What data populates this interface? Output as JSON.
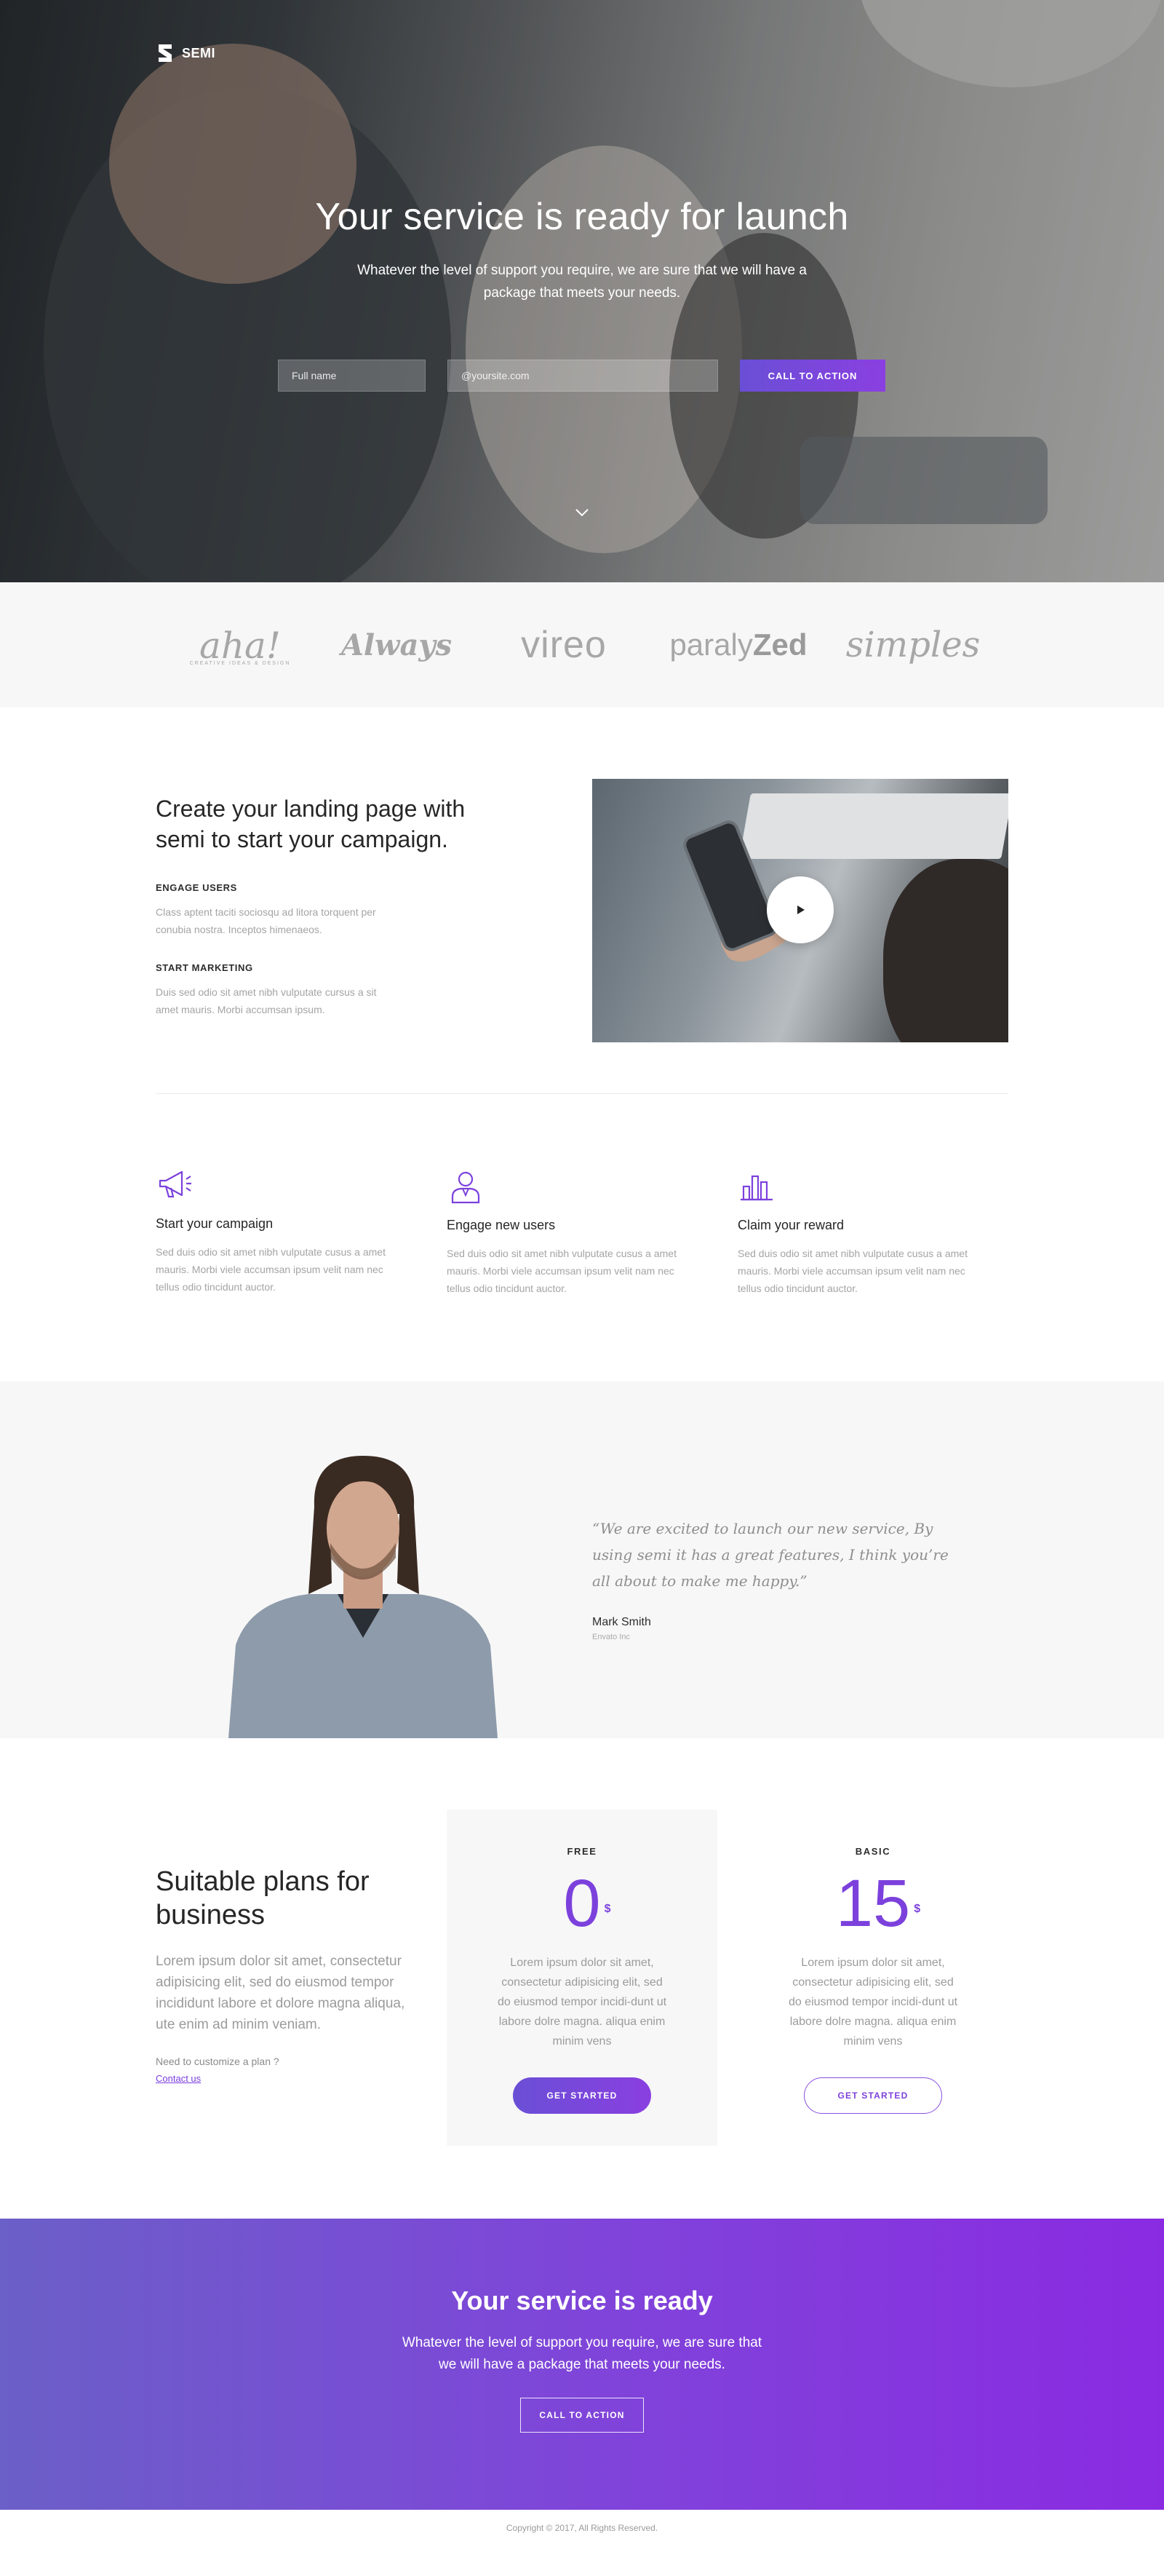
{
  "brand": {
    "name": "SEMI"
  },
  "hero": {
    "title": "Your service is ready for launch",
    "subtitle": "Whatever the level of support you require, we are sure that we will have a package that meets your needs.",
    "name_placeholder": "Full name",
    "email_placeholder": "@yoursite.com",
    "cta_label": "CALL TO ACTION"
  },
  "logos": {
    "aha": "aha!",
    "aha_tagline": "CREATIVE IDEAS & DESIGN",
    "always": "Always",
    "vireo": "vireo",
    "paraly_light": "paraly",
    "paraly_bold": "Zed",
    "simples": "simples"
  },
  "feature": {
    "title": "Create your landing page with semi to start your campaign.",
    "items": [
      {
        "heading": "ENGAGE USERS",
        "text": "Class aptent taciti sociosqu ad litora torquent per conubia nostra. Inceptos himenaeos."
      },
      {
        "heading": "START MARKETING",
        "text": "Duis sed odio sit amet nibh vulputate cursus a sit amet mauris. Morbi accumsan ipsum."
      }
    ]
  },
  "columns": [
    {
      "title": "Start your campaign",
      "text": "Sed duis odio sit amet nibh vulputate cusus a amet mauris. Morbi viele accumsan ipsum velit nam nec tellus odio tincidunt auctor."
    },
    {
      "title": "Engage new users",
      "text": "Sed duis odio sit amet nibh vulputate cusus a amet mauris. Morbi viele accumsan ipsum velit nam nec tellus odio tincidunt auctor."
    },
    {
      "title": "Claim your reward",
      "text": "Sed duis odio sit amet nibh vulputate cusus a amet mauris. Morbi viele accumsan ipsum velit nam nec tellus odio tincidunt auctor."
    }
  ],
  "testimonial": {
    "quote": "“We are excited to launch our new service, By using semi it has a great features, I think you’re all about to make me happy.”",
    "name": "Mark Smith",
    "org": "Envato Inc"
  },
  "pricing": {
    "title": "Suitable plans for business",
    "description": "Lorem ipsum dolor sit amet, consectetur adipisicing elit, sed do eiusmod tempor incididunt labore et dolore magna aliqua, ute enim ad minim veniam.",
    "customize": "Need to customize a plan ?",
    "contact": "Contact us",
    "plans": [
      {
        "tier": "FREE",
        "price": "0",
        "currency": "$",
        "description": "Lorem ipsum dolor sit amet, consectetur adipisicing elit, sed do eiusmod tempor incidi-dunt ut labore dolre magna. aliqua enim minim vens",
        "button": "GET STARTED"
      },
      {
        "tier": "BASIC",
        "price": "15",
        "currency": "$",
        "description": "Lorem ipsum dolor sit amet, consectetur adipisicing elit, sed do eiusmod tempor incidi-dunt ut labore dolre magna. aliqua enim minim vens",
        "button": "GET STARTED"
      }
    ]
  },
  "cta": {
    "title": "Your service is ready",
    "text": "Whatever the level of support you require, we are sure that we will have a package that meets your needs.",
    "button": "CALL TO ACTION"
  },
  "footer": {
    "copyright": "Copyright © 2017, All Rights Reserved."
  },
  "colors": {
    "accent": "#7c41dc",
    "accent_gradient_start": "#6b5fc8",
    "accent_gradient_end": "#8a2be2"
  },
  "icons": [
    "semi-logo-icon",
    "chevron-down-icon",
    "play-icon",
    "megaphone-icon",
    "user-icon",
    "bar-chart-icon"
  ]
}
